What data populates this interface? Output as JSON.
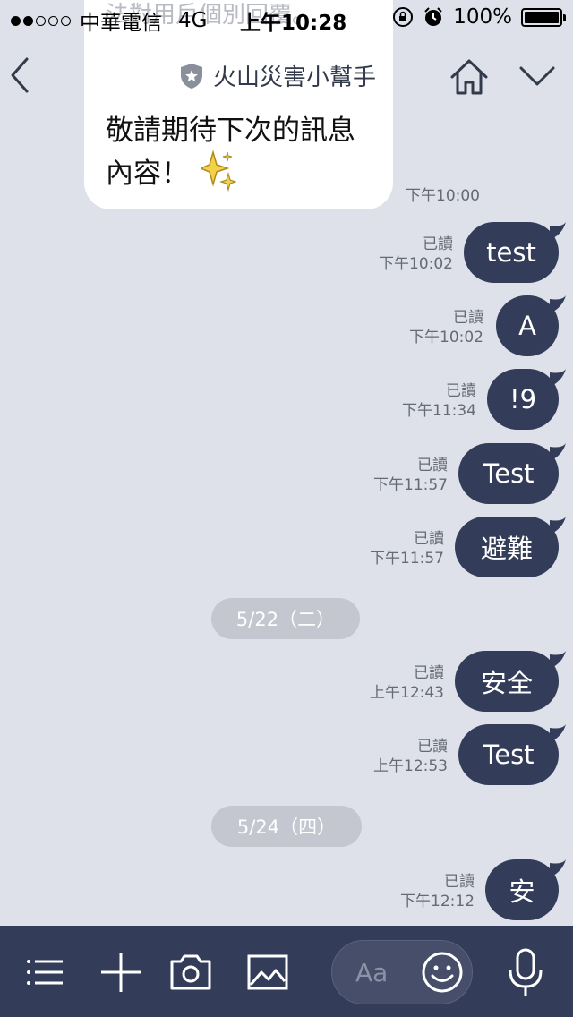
{
  "status_bar": {
    "carrier": "中華電信",
    "network": "4G",
    "time": "上午10:28",
    "battery": "100%",
    "signal_dots_filled": 2,
    "signal_dots_total": 5
  },
  "header": {
    "title": "火山災害小幫手"
  },
  "incoming": {
    "faded_text": "法對用戶個別回覆。",
    "text_line1": "敬請期待下次的訊息",
    "text_line2": "內容！",
    "time": "下午10:00"
  },
  "messages": [
    {
      "text": "test",
      "read": "已讀",
      "time": "下午10:02"
    },
    {
      "text": "A",
      "read": "已讀",
      "time": "下午10:02"
    },
    {
      "text": "!9",
      "read": "已讀",
      "time": "下午11:34"
    },
    {
      "text": "Test",
      "read": "已讀",
      "time": "下午11:57"
    },
    {
      "text": "避難",
      "read": "已讀",
      "time": "下午11:57"
    },
    {
      "text": "安全",
      "read": "已讀",
      "time": "上午12:43"
    },
    {
      "text": "Test",
      "read": "已讀",
      "time": "上午12:53"
    },
    {
      "text": "安",
      "read": "已讀",
      "time": "下午12:12"
    }
  ],
  "date_separators": [
    "5/22（二）",
    "5/24（四）"
  ],
  "input": {
    "placeholder": "Aa"
  },
  "toolbar_icons": [
    "menu-icon",
    "plus-icon",
    "camera-icon",
    "image-icon",
    "emoji-icon",
    "microphone-icon"
  ],
  "colors": {
    "background": "#dee1ea",
    "bubble": "#333c58",
    "bottom_bar": "#333c58"
  }
}
